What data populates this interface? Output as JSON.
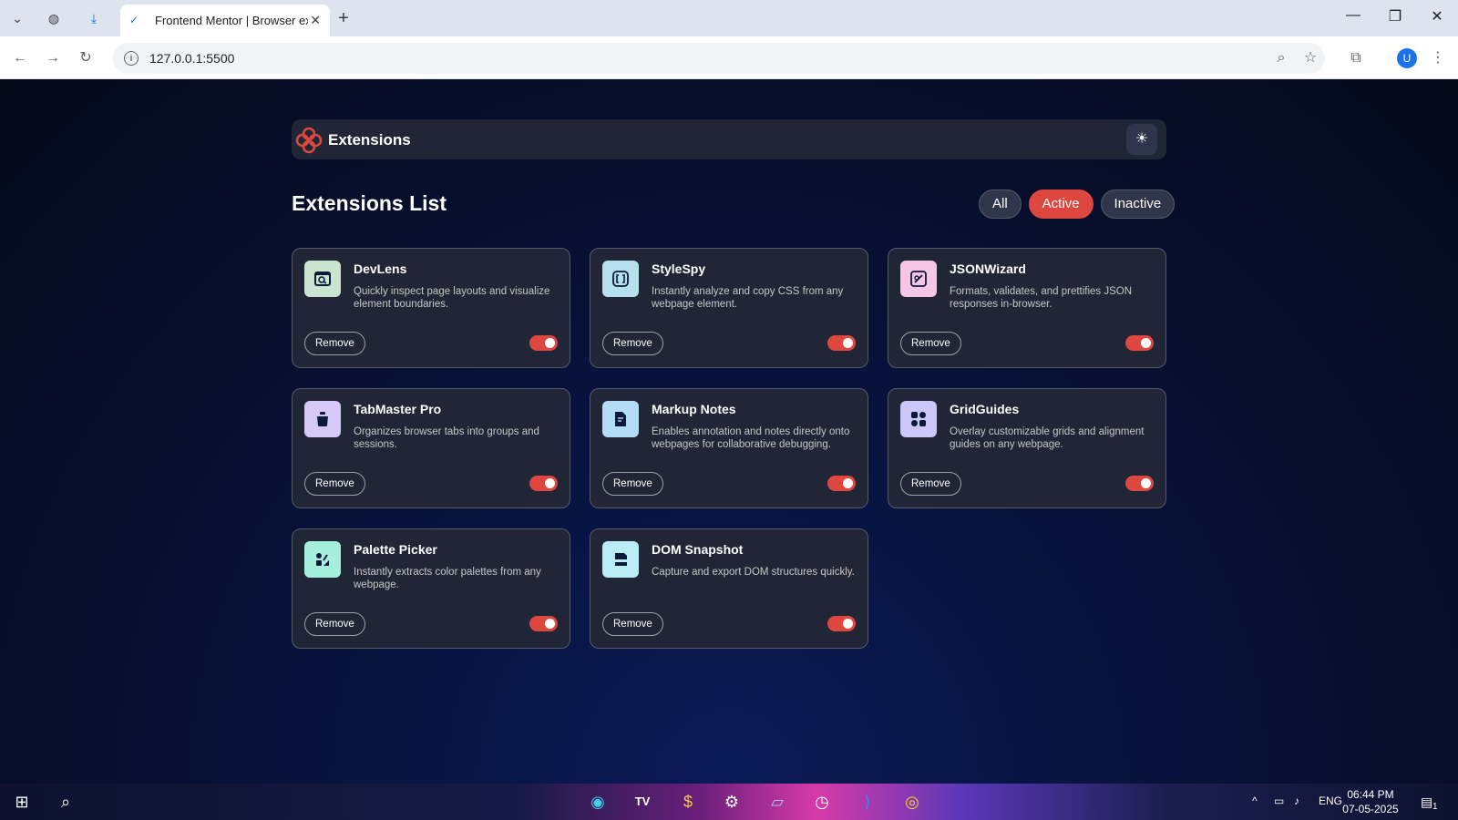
{
  "browser": {
    "tab_title": "Frontend Mentor | Browser exte",
    "url": "127.0.0.1:5500",
    "profile_initial": "U"
  },
  "app": {
    "brand": "Extensions",
    "list_title": "Extensions List",
    "filters": [
      {
        "label": "All",
        "active": false
      },
      {
        "label": "Active",
        "active": true
      },
      {
        "label": "Inactive",
        "active": false
      }
    ],
    "remove_label": "Remove",
    "accent_color": "#de473f",
    "extensions": [
      {
        "name": "DevLens",
        "desc": "Quickly inspect page layouts and visualize element boundaries.",
        "icon": "devlens-icon",
        "icon_bg": "#c9e4cf",
        "enabled": true
      },
      {
        "name": "StyleSpy",
        "desc": "Instantly analyze and copy CSS from any webpage element.",
        "icon": "stylespy-icon",
        "icon_bg": "#b7e0ef",
        "enabled": true
      },
      {
        "name": "JSONWizard",
        "desc": "Formats, validates, and prettifies JSON responses in-browser.",
        "icon": "jsonwizard-icon",
        "icon_bg": "#f6c6e6",
        "enabled": true
      },
      {
        "name": "TabMaster Pro",
        "desc": "Organizes browser tabs into groups and sessions.",
        "icon": "tabmaster-icon",
        "icon_bg": "#d7c9f7",
        "enabled": true
      },
      {
        "name": "Markup Notes",
        "desc": "Enables annotation and notes directly onto webpages for collaborative debugging.",
        "icon": "markup-notes-icon",
        "icon_bg": "#b5dcf7",
        "enabled": true
      },
      {
        "name": "GridGuides",
        "desc": "Overlay customizable grids and alignment guides on any webpage.",
        "icon": "gridguides-icon",
        "icon_bg": "#cbc7f8",
        "enabled": true
      },
      {
        "name": "Palette Picker",
        "desc": "Instantly extracts color palettes from any webpage.",
        "icon": "palette-picker-icon",
        "icon_bg": "#a6efdc",
        "enabled": true
      },
      {
        "name": "DOM Snapshot",
        "desc": "Capture and export DOM structures quickly.",
        "icon": "dom-snapshot-icon",
        "icon_bg": "#b9ecf4",
        "enabled": true
      }
    ]
  },
  "taskbar": {
    "language": "ENG",
    "time": "06:44 PM",
    "date": "07-05-2025",
    "notification_count": "1"
  }
}
